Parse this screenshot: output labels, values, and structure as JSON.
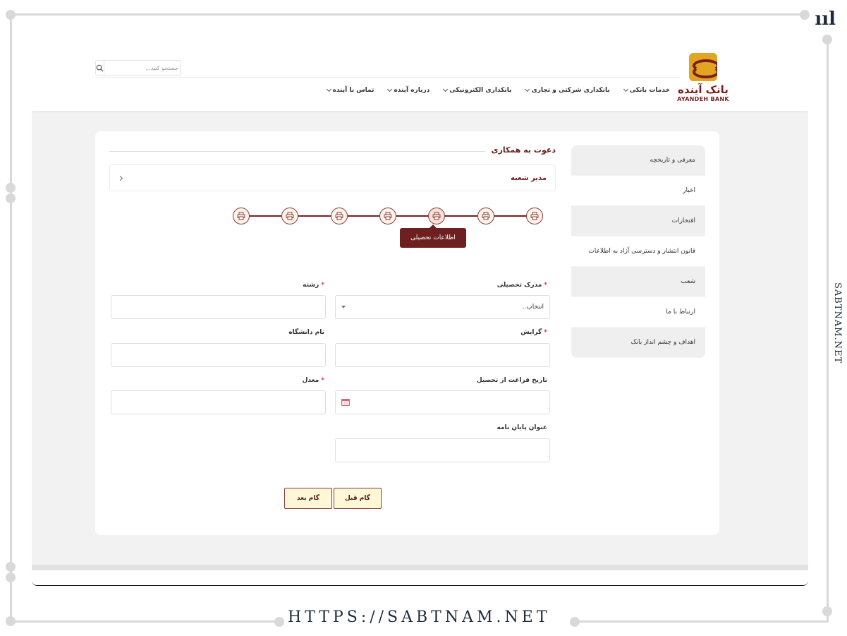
{
  "watermark": {
    "brand_mark": "ııl",
    "side_text": "SABTNAM.NET",
    "bottom_text": "HTTPS://SABTNAM.NET"
  },
  "header": {
    "logo_name": "بانک آینده",
    "logo_en": "AYANDEH BANK",
    "search_placeholder": "جستجو کنید...",
    "nav": [
      {
        "label": "خدمات بانکی"
      },
      {
        "label": "بانکداری شرکتی و تجاری"
      },
      {
        "label": "بانکداری الکترونیکی"
      },
      {
        "label": "درباره آینده"
      },
      {
        "label": "تماس با آینده"
      }
    ]
  },
  "sidebar": {
    "items": [
      {
        "label": "معرفی و تاریخچه"
      },
      {
        "label": "اخبار"
      },
      {
        "label": "افتخارات"
      },
      {
        "label": "قانون انتشار و دسترسی آزاد به اطلاعات"
      },
      {
        "label": "شعب"
      },
      {
        "label": "ارتباط با ما"
      },
      {
        "label": "اهداف و چشم انداز بانک"
      }
    ]
  },
  "main": {
    "title": "دعوت به همکاری",
    "job_title": "مدیر شعبه",
    "steps": {
      "count": 7,
      "active_index": 4,
      "active_label": "اطلاعات تحصیلی",
      "icon": "printer-icon"
    },
    "form": {
      "degree": {
        "label": "مدرک تحصیلی",
        "required": true,
        "value": "انتخاب.."
      },
      "major": {
        "label": "رشته",
        "required": true,
        "value": ""
      },
      "orientation": {
        "label": "گرایش",
        "required": true,
        "value": ""
      },
      "university": {
        "label": "نام دانشگاه",
        "required": false,
        "value": ""
      },
      "graduation_date": {
        "label": "تاریخ فراغت از تحصیل",
        "required": false,
        "value": ""
      },
      "gpa": {
        "label": "معدل",
        "required": true,
        "value": ""
      },
      "thesis": {
        "label": "عنوان پایان نامه",
        "required": false,
        "value": ""
      },
      "required_mark": "*"
    },
    "buttons": {
      "prev": "گام قبل",
      "next": "گام بعد"
    }
  },
  "colors": {
    "brand": "#6e1f1f",
    "accent": "#e3a521",
    "button_bg": "#fff7d6"
  }
}
